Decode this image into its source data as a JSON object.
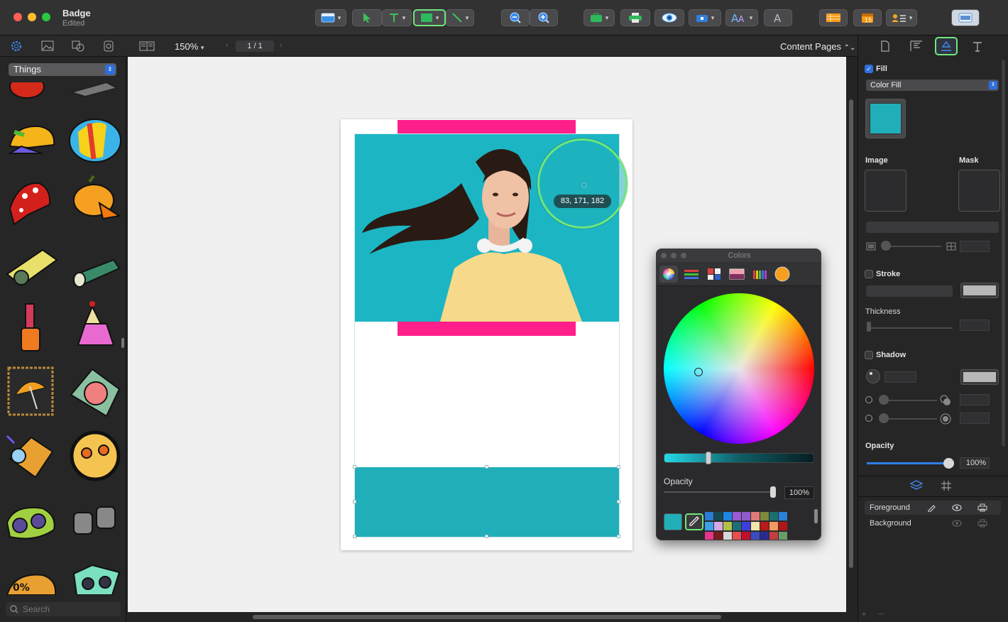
{
  "window": {
    "title": "Badge",
    "subtitle": "Edited"
  },
  "subbar": {
    "zoom": "150%",
    "page_indicator": "1 / 1",
    "content_pages": "Content Pages"
  },
  "library": {
    "category": "Things",
    "search_placeholder": "Search",
    "clipart": [
      "pepper",
      "hand-tool",
      "baseball-cap",
      "beach-ball",
      "bandana",
      "pumpkin",
      "flashlight",
      "flashlight-green",
      "nail-polish",
      "birthday-cake",
      "umbrella-frame",
      "hat-box",
      "binoculars",
      "glasses-bowl",
      "binoculars-purple",
      "binoculars-gray",
      "number-sign",
      "binoculars-dark"
    ]
  },
  "canvas": {
    "loupe_rgb": "83, 171, 182",
    "accent_pink": "#ff1f8a",
    "accent_teal": "#20aeb9"
  },
  "colors_panel": {
    "title": "Colors",
    "opacity_label": "Opacity",
    "opacity_value": "100%",
    "current_color": "#20aeb9",
    "opacity_fraction": 1.0,
    "swatches": [
      [
        "#2a7bd6",
        "#164a52",
        "#1e86e0",
        "#9b59d4",
        "#8e5bc9",
        "#e07b7b",
        "#7e8a3a",
        "#1f6e6e",
        "#2b80d9"
      ],
      [
        "#3fa0e8",
        "#d6a8e8",
        "#b0c24a",
        "#1d6f78",
        "#3e3ee0",
        "#f0e6a8",
        "#b8191a",
        "#f29a60",
        "#b21515"
      ],
      [
        "#e8348c",
        "#7a1c1c",
        "#d8d8d8",
        "#e85050",
        "#c01030",
        "#3b4ec0",
        "#2a2a90",
        "#c04040",
        "#6a9a6a"
      ]
    ]
  },
  "inspector": {
    "fill_label": "Fill",
    "fill_type": "Color Fill",
    "fill_color": "#20aeb9",
    "image_label": "Image",
    "mask_label": "Mask",
    "stroke_label": "Stroke",
    "thickness_label": "Thickness",
    "shadow_label": "Shadow",
    "opacity_label": "Opacity",
    "opacity_value": "100%",
    "opacity_fraction": 1.0,
    "layers": [
      {
        "name": "Foreground"
      },
      {
        "name": "Background"
      }
    ]
  }
}
